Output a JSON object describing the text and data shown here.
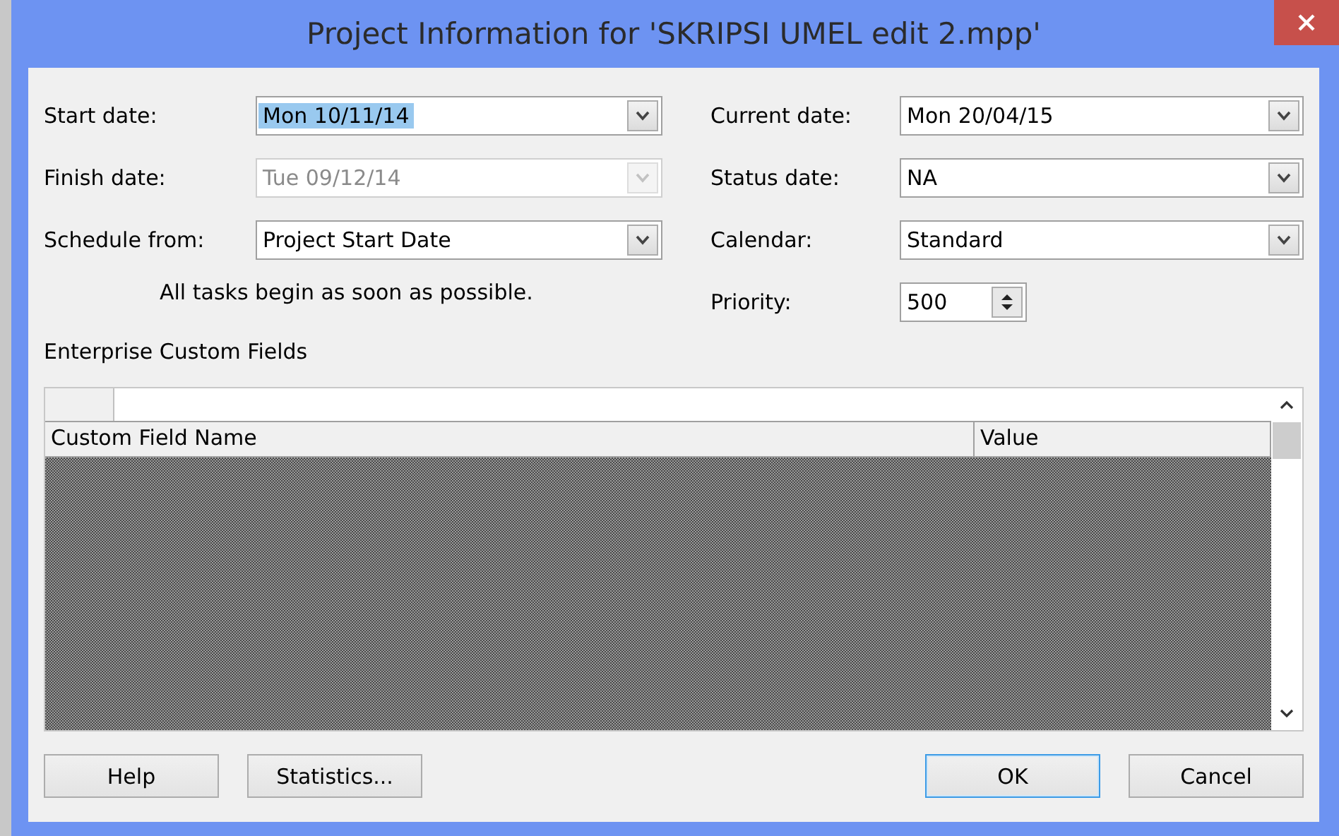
{
  "window": {
    "title": "Project Information for 'SKRIPSI UMEL edit 2.mpp'"
  },
  "left_fields": [
    {
      "label": "Start date:",
      "kind": "combo",
      "value": "Mon 10/11/14",
      "disabled": false,
      "highlighted": true
    },
    {
      "label": "Finish date:",
      "kind": "combo",
      "value": "Tue 09/12/14",
      "disabled": true,
      "highlighted": false
    },
    {
      "label": "Schedule from:",
      "kind": "combo",
      "value": "Project Start Date",
      "disabled": false,
      "highlighted": false
    }
  ],
  "note": "All tasks begin as soon as possible.",
  "right_fields": [
    {
      "label": "Current date:",
      "kind": "combo",
      "value": "Mon 20/04/15",
      "disabled": false,
      "highlighted": false
    },
    {
      "label": "Status date:",
      "kind": "combo",
      "value": "NA",
      "disabled": false,
      "highlighted": false
    },
    {
      "label": "Calendar:",
      "kind": "combo",
      "value": "Standard",
      "disabled": false,
      "highlighted": false
    },
    {
      "label": "Priority:",
      "kind": "spin",
      "value": "500",
      "disabled": false,
      "highlighted": false
    }
  ],
  "custom_fields": {
    "title": "Enterprise Custom Fields",
    "columns": [
      "Custom Field Name",
      "Value"
    ]
  },
  "buttons": [
    {
      "label": "Help",
      "default": false
    },
    {
      "label": "Statistics...",
      "default": false
    },
    {
      "label": "OK",
      "default": true
    },
    {
      "label": "Cancel",
      "default": false
    }
  ]
}
